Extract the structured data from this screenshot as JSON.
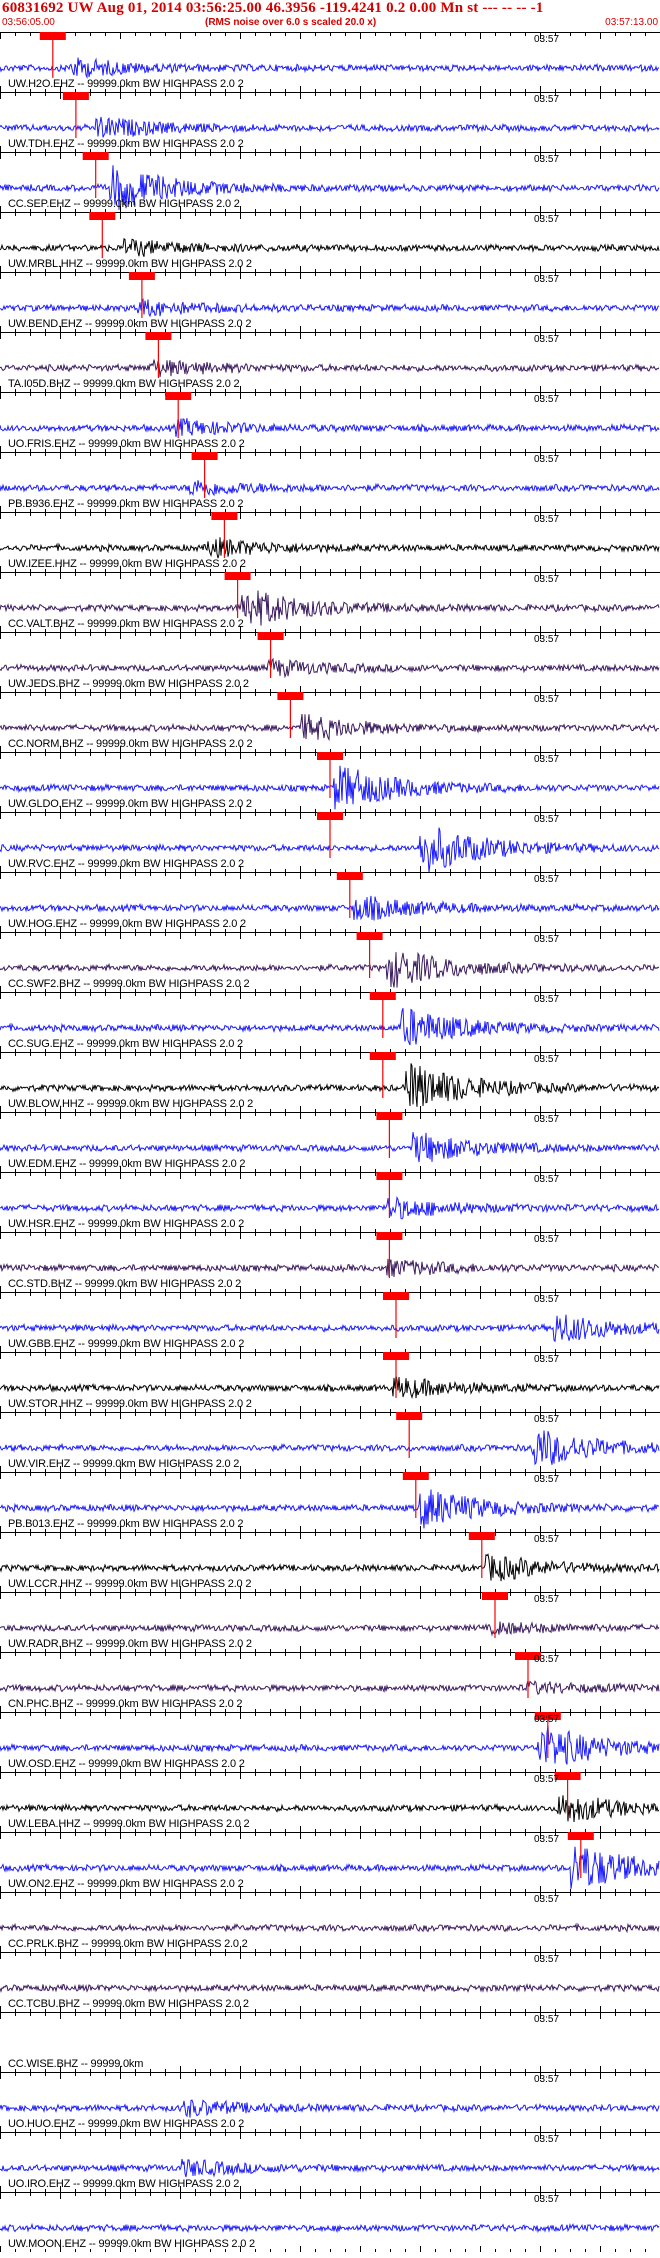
{
  "header": {
    "title": "60831692 UW Aug 01, 2014 03:56:25.00   46.3956 -119.4241  0.2 0.00 Mn st --- -- --  -1",
    "start_time": "03:56:05.00",
    "noise_note": "(RMS noise over 6.0 s scaled 20.0 x)",
    "end_time": "03:57:13.00"
  },
  "colors": {
    "title": "#d40000",
    "blue_trace": "#1a1aff",
    "black_trace": "#000000",
    "purple_trace": "#3a1a5e",
    "pick": "#ff0000"
  },
  "tick_label": "03:57",
  "traces": [
    {
      "label": "UW.H2O.EHZ -- 99999.0km BW  HIGHPASS  2.0  2",
      "color": "blue",
      "pick": 0.08,
      "amp": 0.35,
      "burst": 0.12
    },
    {
      "label": "UW.TDH.EHZ -- 99999.0km BW  HIGHPASS  2.0  2",
      "color": "blue",
      "pick": 0.115,
      "amp": 0.4,
      "burst": 0.16
    },
    {
      "label": "CC.SEP.EHZ -- 99999.0km BW  HIGHPASS  2.0  2",
      "color": "blue",
      "pick": 0.145,
      "amp": 0.9,
      "burst": 0.18
    },
    {
      "label": "UW.MRBL.HHZ -- 99999.0km BW  HIGHPASS  2.0  2",
      "color": "black",
      "pick": 0.155,
      "amp": 0.3,
      "burst": 0.2
    },
    {
      "label": "UW.BEND.EHZ -- 99999.0km BW  HIGHPASS  2.0  2",
      "color": "blue",
      "pick": 0.215,
      "amp": 0.3,
      "burst": 0.22
    },
    {
      "label": "TA.I05D.BHZ -- 99999.0km BW  HIGHPASS  2.0  2",
      "color": "purple",
      "pick": 0.24,
      "amp": 0.3,
      "burst": 0.24
    },
    {
      "label": "UO.FRIS.EHZ -- 99999.0km BW  HIGHPASS  2.0  2",
      "color": "blue",
      "pick": 0.27,
      "amp": 0.3,
      "burst": 0.28
    },
    {
      "label": "PB.B936.EHZ -- 99999.0km BW  HIGHPASS  2.0  2",
      "color": "blue",
      "pick": 0.31,
      "amp": 0.3,
      "burst": 0.3
    },
    {
      "label": "UW.IZEE.HHZ -- 99999.0km BW  HIGHPASS  2.0  2",
      "color": "black",
      "pick": 0.34,
      "amp": 0.35,
      "burst": 0.33
    },
    {
      "label": "CC.VALT.BHZ -- 99999.0km BW  HIGHPASS  2.0  2",
      "color": "purple",
      "pick": 0.36,
      "amp": 0.8,
      "burst": 0.38
    },
    {
      "label": "UW.JEDS.BHZ -- 99999.0km BW  HIGHPASS  2.0  2",
      "color": "purple",
      "pick": 0.41,
      "amp": 0.3,
      "burst": 0.42
    },
    {
      "label": "CC.NORM.BHZ -- 99999.0km BW  HIGHPASS  2.0  2",
      "color": "purple",
      "pick": 0.44,
      "amp": 0.5,
      "burst": 0.47
    },
    {
      "label": "UW.GLDO.EHZ -- 99999.0km BW  HIGHPASS  2.0  2",
      "color": "blue",
      "pick": 0.5,
      "amp": 0.9,
      "burst": 0.52
    },
    {
      "label": "UW.RVC.EHZ -- 99999.0km BW  HIGHPASS  2.0  2",
      "color": "blue",
      "pick": 0.5,
      "amp": 1.0,
      "burst": 0.65
    },
    {
      "label": "UW.HOG.EHZ -- 99999.0km BW  HIGHPASS  2.0  2",
      "color": "blue",
      "pick": 0.53,
      "amp": 0.5,
      "burst": 0.55
    },
    {
      "label": "CC.SWF2.BHZ -- 99999.0km BW  HIGHPASS  2.0  2",
      "color": "purple",
      "pick": 0.56,
      "amp": 0.8,
      "burst": 0.6
    },
    {
      "label": "CC.SUG.EHZ -- 99999.0km BW  HIGHPASS  2.0  2",
      "color": "blue",
      "pick": 0.58,
      "amp": 0.8,
      "burst": 0.62
    },
    {
      "label": "UW.BLOW.HHZ -- 99999.0km BW  HIGHPASS  2.0  2",
      "color": "black",
      "pick": 0.58,
      "amp": 1.0,
      "burst": 0.63
    },
    {
      "label": "UW.EDM.EHZ -- 99999.0km BW  HIGHPASS  2.0  2",
      "color": "blue",
      "pick": 0.59,
      "amp": 0.6,
      "burst": 0.64
    },
    {
      "label": "UW.HSR.EHZ -- 99999.0km BW  HIGHPASS  2.0  2",
      "color": "blue",
      "pick": 0.59,
      "amp": 0.4,
      "burst": 0.6
    },
    {
      "label": "CC.STD.BHZ -- 99999.0km BW  HIGHPASS  2.0  2",
      "color": "purple",
      "pick": 0.59,
      "amp": 0.3,
      "burst": 0.6
    },
    {
      "label": "UW.GBB.EHZ -- 99999.0km BW  HIGHPASS  2.0  2",
      "color": "blue",
      "pick": 0.6,
      "amp": 0.6,
      "burst": 0.85
    },
    {
      "label": "UW.STOR.HHZ -- 99999.0km BW  HIGHPASS  2.0  2",
      "color": "black",
      "pick": 0.6,
      "amp": 0.4,
      "burst": 0.61
    },
    {
      "label": "UW.VIR.EHZ -- 99999.0km BW  HIGHPASS  2.0  2",
      "color": "blue",
      "pick": 0.62,
      "amp": 0.8,
      "burst": 0.82
    },
    {
      "label": "PB.B013.EHZ -- 99999.0km BW  HIGHPASS  2.0  2",
      "color": "blue",
      "pick": 0.63,
      "amp": 0.8,
      "burst": 0.65
    },
    {
      "label": "UW.LCCR.HHZ -- 99999.0km BW  HIGHPASS  2.0  2",
      "color": "black",
      "pick": 0.73,
      "amp": 0.5,
      "burst": 0.75
    },
    {
      "label": "UW.RADR.BHZ -- 99999.0km BW  HIGHPASS  2.0  2",
      "color": "purple",
      "pick": 0.75,
      "amp": 0.2,
      "burst": 0.76
    },
    {
      "label": "CN.PHC.BHZ -- 99999.0km BW  HIGHPASS  2.0  2",
      "color": "purple",
      "pick": 0.8,
      "amp": 0.2,
      "burst": 0.81
    },
    {
      "label": "UW.OSD.EHZ -- 99999.0km BW  HIGHPASS  2.0  2",
      "color": "blue",
      "pick": 0.83,
      "amp": 0.9,
      "burst": 0.83
    },
    {
      "label": "UW.LEBA.HHZ -- 99999.0km BW  HIGHPASS  2.0  2",
      "color": "black",
      "pick": 0.86,
      "amp": 0.6,
      "burst": 0.86
    },
    {
      "label": "UW.ON2.EHZ -- 99999.0km BW  HIGHPASS  2.0  2",
      "color": "blue",
      "pick": 0.88,
      "amp": 1.0,
      "burst": 0.88
    },
    {
      "label": "CC.PRLK.BHZ -- 99999.0km BW  HIGHPASS  2.0  2",
      "color": "purple",
      "pick": null,
      "amp": 0.1,
      "burst": null
    },
    {
      "label": "CC.TCBU.BHZ -- 99999.0km BW  HIGHPASS  2.0  2",
      "color": "purple",
      "pick": null,
      "amp": 0.1,
      "burst": null
    },
    {
      "label": "CC.WISE.BHZ -- 99999.0km",
      "color": "none",
      "pick": null,
      "amp": 0,
      "burst": null
    },
    {
      "label": "UO.HUO.EHZ -- 99999.0km BW  HIGHPASS  2.0  2",
      "color": "blue",
      "pick": null,
      "amp": 0.3,
      "burst": 0.29
    },
    {
      "label": "UO.IRO.EHZ -- 99999.0km BW  HIGHPASS  2.0  2",
      "color": "blue",
      "pick": null,
      "amp": 0.3,
      "burst": 0.29
    },
    {
      "label": "UW.MOON.EHZ -- 99999.0km BW  HIGHPASS  2.0  2",
      "color": "blue",
      "pick": null,
      "amp": 0.25,
      "burst": null
    }
  ]
}
